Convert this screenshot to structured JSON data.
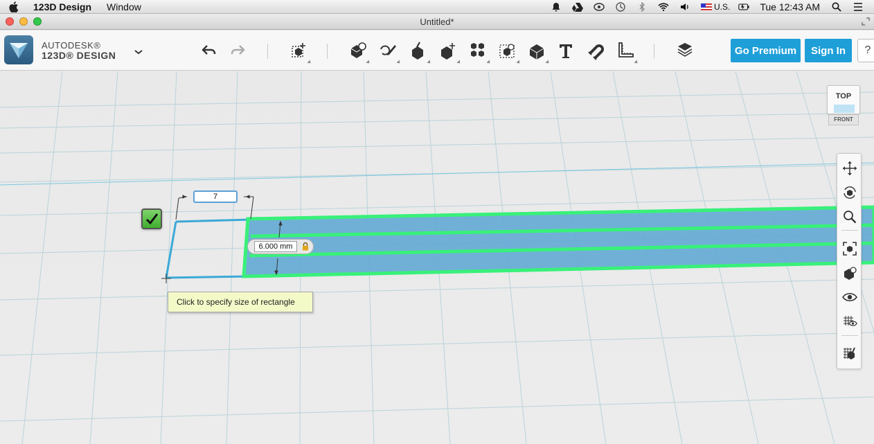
{
  "menubar": {
    "app_name": "123D Design",
    "menu_items": [
      "Window"
    ],
    "input_source": "U.S.",
    "clock": "Tue 12:43 AM"
  },
  "window": {
    "title": "Untitled*"
  },
  "toolbar": {
    "brand_line1": "AUTODESK®",
    "brand_line2": "123D® DESIGN",
    "go_premium": "Go Premium",
    "sign_in": "Sign In",
    "help": "?",
    "accent_color": "#1e9fd8"
  },
  "viewcube": {
    "top_label": "TOP",
    "front_label": "FRONT"
  },
  "sketch": {
    "width_value": "7",
    "height_value": "6.000 mm",
    "tooltip": "Click to specify size of rectangle",
    "highlight_color": "#39f07a",
    "fill_color": "#5aa6d4"
  },
  "navbar": {
    "icons": [
      "pan-icon",
      "orbit-icon",
      "zoom-icon",
      "fit-all-icon",
      "view-cube-icon",
      "visibility-icon",
      "material-view-icon",
      "snap-icon"
    ]
  }
}
